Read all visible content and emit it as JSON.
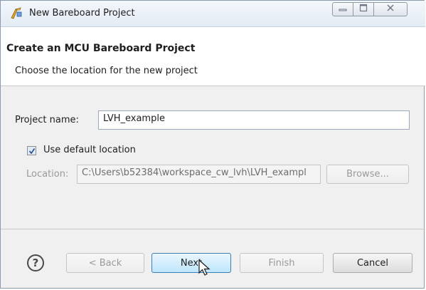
{
  "window": {
    "title": "New Bareboard Project"
  },
  "header": {
    "title": "Create an MCU Bareboard Project",
    "subtitle": "Choose the location for the new project"
  },
  "form": {
    "project_name_label": "Project name:",
    "project_name_value": "LVH_example",
    "use_default_label": "Use default location",
    "use_default_checked": true,
    "location_label": "Location:",
    "location_value": "C:\\Users\\b52384\\workspace_cw_lvh\\LVH_exampl",
    "browse_label": "Browse..."
  },
  "buttons": {
    "back": "< Back",
    "next": "Next",
    "finish": "Finish",
    "cancel": "Cancel"
  },
  "icons": {
    "app": "bareboard-project-icon",
    "help": "help-icon"
  }
}
